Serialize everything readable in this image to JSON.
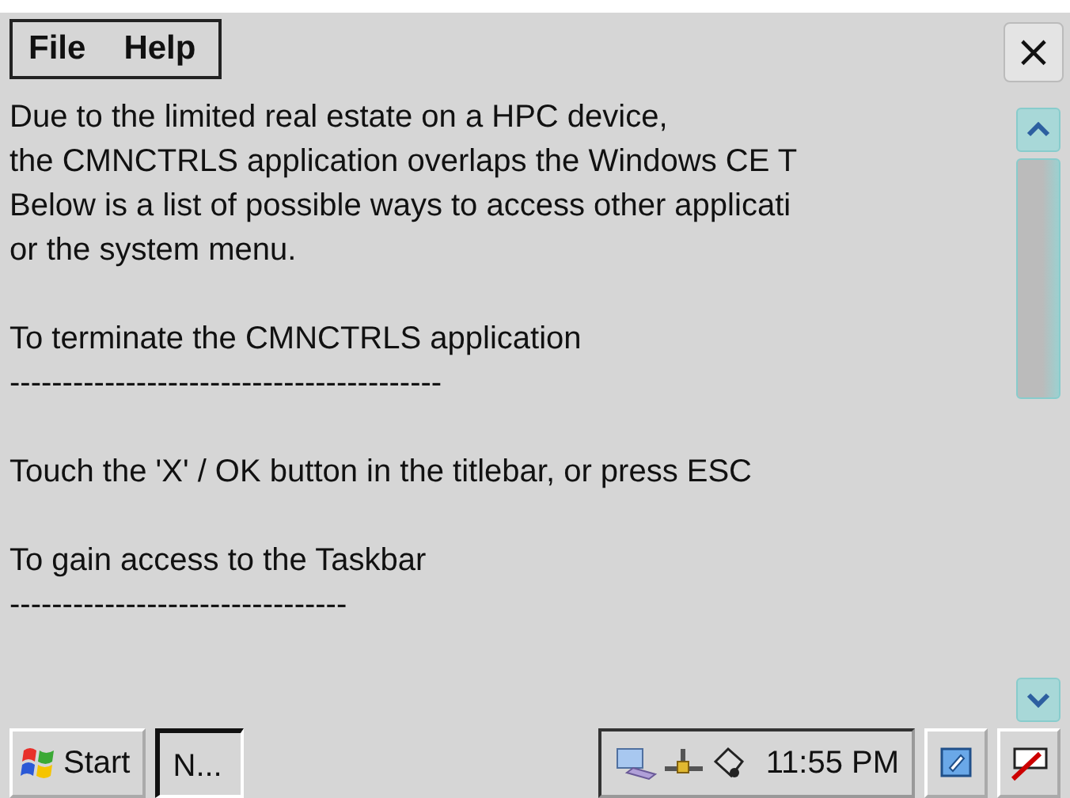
{
  "menu_bar": {
    "items": [
      "File",
      "Help"
    ]
  },
  "close_button": {
    "label": "×"
  },
  "text_view": {
    "paragraphs": [
      {
        "lines": [
          "Due to the limited real estate on a HPC device,",
          "the CMNCTRLS application overlaps the Windows CE T",
          "Below is a list of possible ways to access other applicati",
          "or the system menu."
        ]
      },
      {
        "lines": [
          "To terminate the CMNCTRLS application",
          "-----------------------------------------"
        ]
      },
      {
        "lines": [
          "Touch the 'X' / OK button in the titlebar, or press ESC"
        ]
      },
      {
        "lines": [
          "To gain access to the Taskbar",
          "--------------------------------"
        ]
      }
    ]
  },
  "taskbar": {
    "start": "Start",
    "task": {
      "label": "N...",
      "selected": true
    },
    "clock": "11:55 PM"
  }
}
